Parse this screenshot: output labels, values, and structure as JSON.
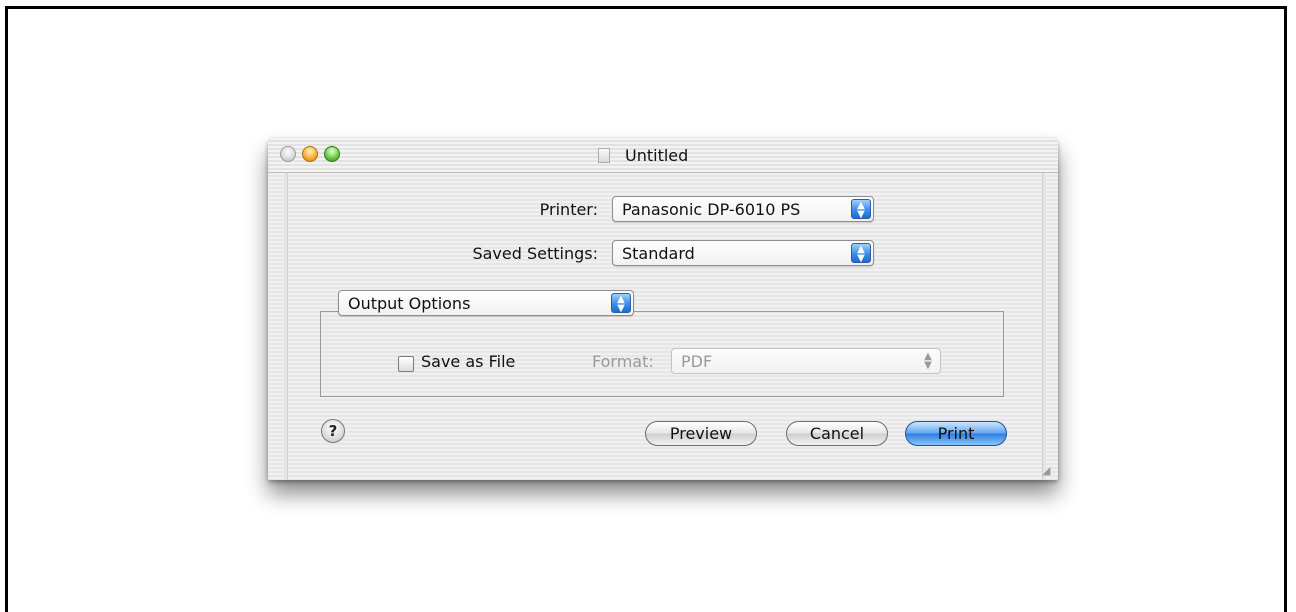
{
  "window": {
    "title": "Untitled"
  },
  "printer": {
    "label": "Printer:",
    "value": "Panasonic DP-6010 PS"
  },
  "saved_settings": {
    "label": "Saved Settings:",
    "value": "Standard"
  },
  "panel": {
    "value": "Output Options"
  },
  "save_as_file": {
    "label": "Save as File",
    "checked": false
  },
  "format": {
    "label": "Format:",
    "value": "PDF",
    "enabled": false
  },
  "buttons": {
    "help": "?",
    "preview": "Preview",
    "cancel": "Cancel",
    "print": "Print"
  },
  "icons": {
    "close": "close-icon",
    "minimize": "minimize-icon",
    "zoom": "zoom-icon",
    "document": "document-icon",
    "popup_arrows": "updown-arrows-icon",
    "resize": "resize-grip-icon",
    "help": "help-icon"
  },
  "colors": {
    "default_button": "#2e7de0",
    "close": "#d8d8d8",
    "minimize": "#f6b23a",
    "zoom": "#73c94a"
  }
}
